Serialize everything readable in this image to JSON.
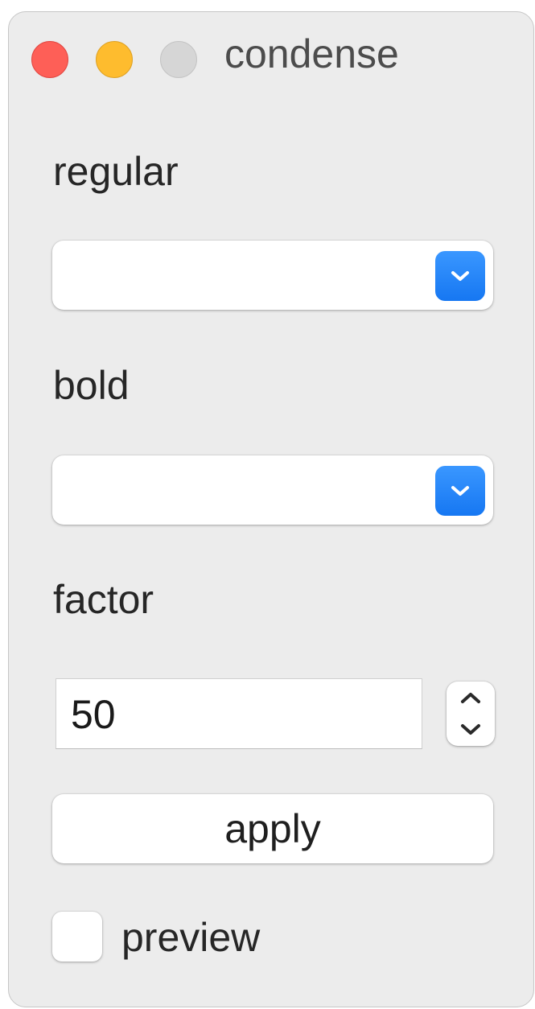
{
  "window": {
    "title": "condense",
    "traffic_lights": {
      "close_color": "#fe5f57",
      "minimize_color": "#febc2e",
      "zoom_color": "#d6d6d6"
    }
  },
  "regular": {
    "label": "regular",
    "selected": "",
    "icon": "chevron-down-icon"
  },
  "bold": {
    "label": "bold",
    "selected": "",
    "icon": "chevron-down-icon"
  },
  "factor": {
    "label": "factor",
    "value": "50",
    "stepper_icons": [
      "chevron-up-icon",
      "chevron-down-icon"
    ]
  },
  "apply": {
    "label": "apply"
  },
  "preview": {
    "label": "preview",
    "checked": false
  },
  "colors": {
    "accent": "#1677f2",
    "window_bg": "#ececec"
  }
}
